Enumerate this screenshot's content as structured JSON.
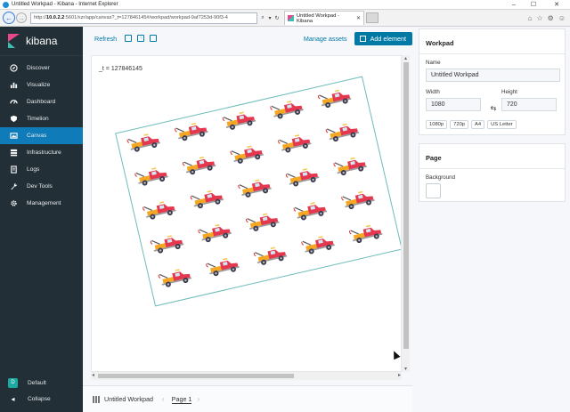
{
  "browser": {
    "window_title": "Untitled Workpad - Kibana - Internet Explorer",
    "address_prefix": "http://",
    "address_host": "10.0.2.2",
    "address_rest": ":5601/xzr/app/canvas?_t=127846145#/workpad/workpad-9af7253d-90f3-4",
    "tab_title": "Untitled Workpad - Kibana",
    "minimize": "–",
    "maximize": "☐",
    "close": "✕"
  },
  "sidebar": {
    "logo_text": "kibana",
    "items": [
      {
        "label": "Discover",
        "icon": "compass-icon"
      },
      {
        "label": "Visualize",
        "icon": "bar-chart-icon"
      },
      {
        "label": "Dashboard",
        "icon": "dashboard-icon"
      },
      {
        "label": "Timelion",
        "icon": "shield-icon"
      },
      {
        "label": "Canvas",
        "icon": "canvas-icon",
        "active": true
      },
      {
        "label": "Infrastructure",
        "icon": "infrastructure-icon"
      },
      {
        "label": "Logs",
        "icon": "logs-icon"
      },
      {
        "label": "Dev Tools",
        "icon": "wrench-icon"
      },
      {
        "label": "Management",
        "icon": "gear-icon"
      }
    ],
    "space_avatar": "D",
    "space_label": "Default",
    "collapse_label": "Collapse"
  },
  "toolbar": {
    "refresh_label": "Refresh",
    "manage_assets_label": "Manage assets",
    "add_element_label": "Add element"
  },
  "canvas": {
    "variable_text": "_t = 127846145"
  },
  "footer": {
    "workpad_name": "Untitled Workpad",
    "page_label": "Page 1"
  },
  "workpad_panel": {
    "heading": "Workpad",
    "name_label": "Name",
    "name_value": "Untitled Workpad",
    "width_label": "Width",
    "width_value": "1080",
    "height_label": "Height",
    "height_value": "720",
    "presets": [
      "1080p",
      "720p",
      "A4",
      "US Letter"
    ]
  },
  "page_panel": {
    "heading": "Page",
    "background_label": "Background",
    "background_color": "#ffffff"
  },
  "colors": {
    "accent": "#0079a5",
    "sidebar_bg": "#222f36",
    "active_nav": "#0f7bb8",
    "truck_red": "#e5384f",
    "truck_orange": "#f5a623"
  }
}
